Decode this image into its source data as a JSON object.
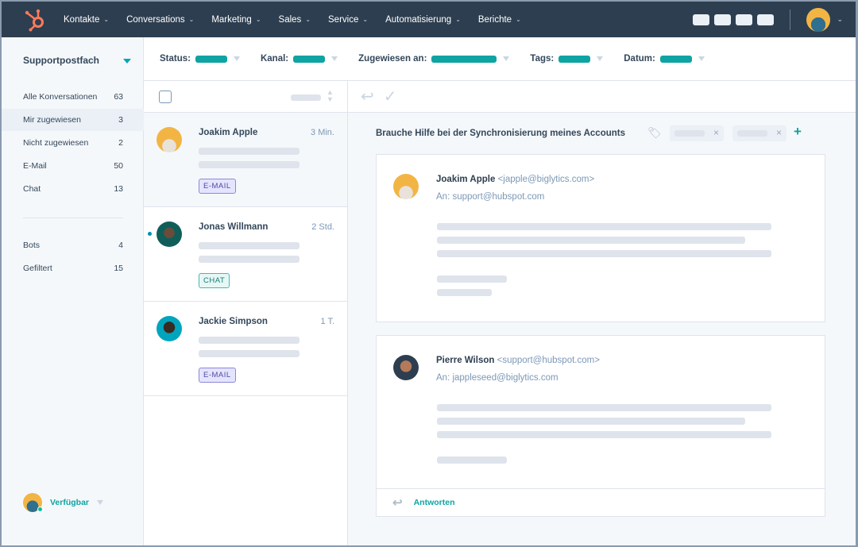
{
  "nav": {
    "items": [
      "Kontakte",
      "Conversations",
      "Marketing",
      "Sales",
      "Service",
      "Automatisierung",
      "Berichte"
    ],
    "brand_color": "#ff7a59"
  },
  "sidebar": {
    "title": "Supportpostfach",
    "items": [
      {
        "label": "Alle Konversationen",
        "count": "63"
      },
      {
        "label": "Mir zugewiesen",
        "count": "3",
        "selected": true
      },
      {
        "label": "Nicht zugewiesen",
        "count": "2"
      },
      {
        "label": "E-Mail",
        "count": "50"
      },
      {
        "label": "Chat",
        "count": "13"
      },
      {
        "label": "Bots",
        "count": "4"
      },
      {
        "label": "Gefiltert",
        "count": "15"
      }
    ],
    "status": "Verfügbar"
  },
  "filters": [
    {
      "label": "Status:"
    },
    {
      "label": "Kanal:"
    },
    {
      "label": "Zugewiesen an:"
    },
    {
      "label": "Tags:"
    },
    {
      "label": "Datum:"
    }
  ],
  "conversations": [
    {
      "name": "Joakim Apple",
      "time": "3 Min.",
      "tag": "E-MAIL"
    },
    {
      "name": "Jonas Willmann",
      "time": "2 Std.",
      "tag": "CHAT",
      "unread": true
    },
    {
      "name": "Jackie Simpson",
      "time": "1 T.",
      "tag": "E-MAIL"
    }
  ],
  "detail": {
    "subject": "Brauche Hilfe bei der Synchronisierung meines Accounts",
    "messages": [
      {
        "sender": "Joakim Apple",
        "email": "<japple@biglytics.com>",
        "to": "An: support@hubspot.com"
      },
      {
        "sender": "Pierre Wilson",
        "email": "<support@hubspot.com>",
        "to": "An: jappleseed@biglytics.com"
      }
    ],
    "reply_label": "Antworten"
  },
  "colors": {
    "accent": "#0fa3a3",
    "nav": "#2d3e50"
  }
}
